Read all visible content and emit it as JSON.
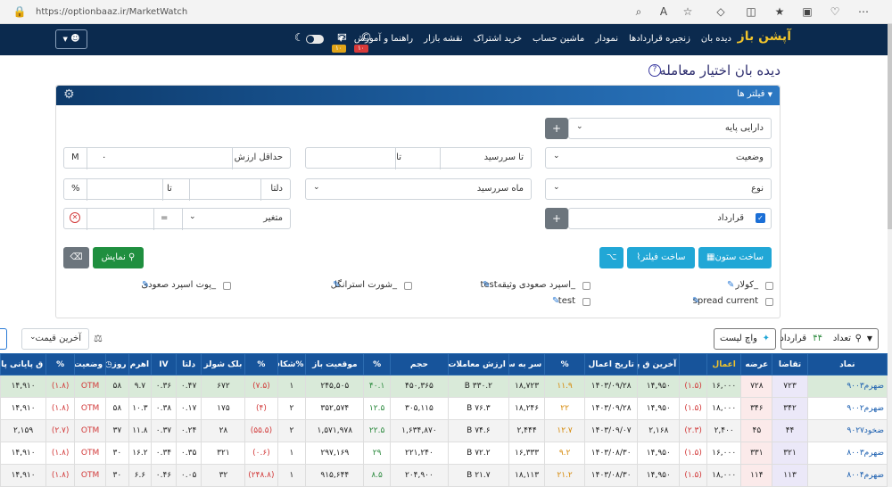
{
  "browser": {
    "url": "https://optionbaaz.ir/MarketWatch"
  },
  "nav": {
    "brand": "آپشن باز",
    "menu": [
      "دیده بان",
      "زنجیره قراردادها",
      "نمودار",
      "ماشین حساب",
      "خرید اشتراک",
      "نقشه بازار",
      "راهنما و آموزش"
    ],
    "badge1": "۱۰",
    "badge2": "۱۰"
  },
  "page": {
    "title": "دیده بان اختیار معامله",
    "info": "?"
  },
  "filter": {
    "header": "فیلتر ها",
    "fields": {
      "underlying": "دارایی پایه",
      "status": "وضعیت",
      "type": "نوع",
      "contract": "قرارداد",
      "to_maturity": "تا سررسید",
      "to_label": "تا",
      "maturity_month": "ماه سررسید",
      "min_value": "حداقل ارزش",
      "min_value_value": "۰",
      "min_value_unit": "M",
      "delta": "دلتا",
      "delta_to": "تا",
      "delta_unit": "%",
      "variable": "متغیر",
      "eq": "="
    },
    "plus": "+",
    "buttons": {
      "build_column": "ساخت ستون",
      "build_filter": "ساخت فیلتر",
      "show": "نمایش"
    },
    "presets": {
      "collar": "_کولار",
      "spread_current": "spread current",
      "ascending_spread_pledge": "_اسپرد صعودی وثیقهtest",
      "test": "test",
      "short_straddle": "_شورت استرانگل",
      "ascending_put_spread": "_پوت اسپرد صعودی"
    }
  },
  "toolbar": {
    "count_label": "تعداد",
    "count_value": "۴۴",
    "count_unit": "قرارداد",
    "watchlist": "واچ لیست",
    "last_price": "آخرین قیمت"
  },
  "table": {
    "headers": [
      "نماد",
      "تقاضا",
      "عرضه",
      "اعمال",
      "آخرین ق پایه",
      "تاریخ اعمال",
      "%",
      "سر به سر",
      "ارزش معاملات",
      "حجم",
      "%",
      "موقعیت باز",
      "%شکاف",
      "%",
      "بلک شولز",
      "دلتا",
      "IV",
      "اهرم",
      "روز",
      "وضعیت",
      "%",
      "ق پایانی پایه"
    ],
    "rows": [
      [
        "ضهرم۹۰۰۳",
        "۷۲۳",
        "۷۲۸",
        "۱۶,۰۰۰",
        "(۱.۵)",
        "۱۴,۹۵۰",
        "۱۴۰۳/۰۹/۲۸",
        "۱۱.۹",
        "۱۸,۷۲۳",
        "۳۳۰.۲ B",
        "۴۵۰,۳۶۵",
        "۴۰.۱",
        "۲۴۵,۵۰۵",
        "۱",
        "(۷.۵)",
        "۶۷۲",
        "۰.۴۷",
        "۰.۳۶",
        "۹.۷",
        "۵۸",
        "OTM",
        "(۱.۸)",
        "۱۴,۹۱۰"
      ],
      [
        "ضهرم۹۰۰۲",
        "۳۴۲",
        "۳۴۶",
        "۱۸,۰۰۰",
        "(۱.۵)",
        "۱۴,۹۵۰",
        "۱۴۰۳/۰۹/۲۸",
        "۲۲",
        "۱۸,۲۴۶",
        "۷۶.۳ B",
        "۳۰۵,۱۱۵",
        "۱۲.۵",
        "۳۵۲,۵۷۴",
        "۲",
        "(۴)",
        "۱۷۵",
        "۰.۱۷",
        "۰.۳۸",
        "۱۰.۳",
        "۵۸",
        "OTM",
        "(۱.۸)",
        "۱۴,۹۱۰"
      ],
      [
        "ضخود۹۰۲۷",
        "۴۴",
        "۴۵",
        "۲,۴۰۰",
        "(۲.۳)",
        "۲,۱۶۸",
        "۱۴۰۳/۰۹/۰۷",
        "۱۲.۷",
        "۲,۴۴۴",
        "۷۴.۶ B",
        "۱,۶۳۴,۸۷۰",
        "۲۲.۵",
        "۱,۵۷۱,۹۷۸",
        "۲",
        "(۵۵.۵)",
        "۲۸",
        "۰.۲۴",
        "۰.۳۷",
        "۱۱.۸",
        "۳۷",
        "OTM",
        "(۲.۷)",
        "۲,۱۵۹"
      ],
      [
        "ضهرم۸۰۰۳",
        "۳۲۱",
        "۳۳۱",
        "۱۶,۰۰۰",
        "(۱.۵)",
        "۱۴,۹۵۰",
        "۱۴۰۳/۰۸/۳۰",
        "۹.۲",
        "۱۶,۳۳۳",
        "۷۲.۲ B",
        "۲۲۱,۲۴۰",
        "۲۹",
        "۲۹۷,۱۶۹",
        "۱",
        "(۰.۶)",
        "۳۲۱",
        "۰.۳۵",
        "۰.۳۴",
        "۱۶.۲",
        "۳۰",
        "OTM",
        "(۱.۸)",
        "۱۴,۹۱۰"
      ],
      [
        "ضهرم۸۰۰۴",
        "۱۱۳",
        "۱۱۴",
        "۱۸,۰۰۰",
        "(۱.۵)",
        "۱۴,۹۵۰",
        "۱۴۰۳/۰۸/۳۰",
        "۲۱.۲",
        "۱۸,۱۱۳",
        "۲۱.۷ B",
        "۲۰۴,۹۰۰",
        "۸.۵",
        "۹۱۵,۶۴۴",
        "۱",
        "(۲۴۸.۸)",
        "۳۲",
        "۰.۰۵",
        "۰.۴۶",
        "۶.۶",
        "۳۰",
        "OTM",
        "(۱.۸)",
        "۱۴,۹۱۰"
      ]
    ]
  }
}
